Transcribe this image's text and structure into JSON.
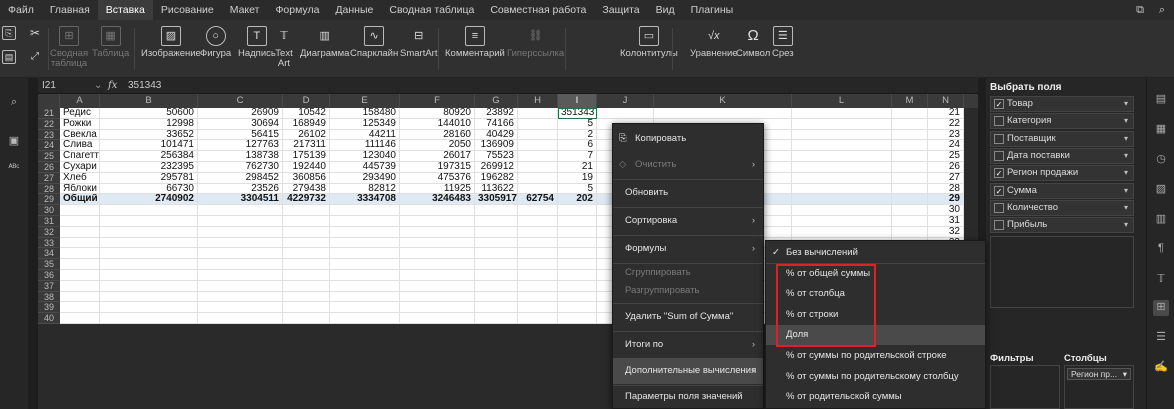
{
  "menu": [
    "Файл",
    "Главная",
    "Вставка",
    "Рисование",
    "Макет",
    "Формула",
    "Данные",
    "Сводная таблица",
    "Совместная работа",
    "Защита",
    "Вид",
    "Плагины"
  ],
  "menu_active": "Вставка",
  "ribbon": {
    "svodnaya": "Сводная таблица",
    "tablica": "Таблица",
    "izobr": "Изображение",
    "figura": "Фигура",
    "nadpis": "Надпись",
    "text_art": "Text Art",
    "diagramma": "Диаграмма",
    "sparklain": "Спарклайн",
    "smartart": "SmartArt",
    "komment": "Комментарий",
    "giperssylka": "Гиперссылка",
    "kolontituly": "Колонтитулы",
    "uravnenie": "Уравнение",
    "simvol": "Символ",
    "srez": "Срез"
  },
  "formula_bar": {
    "cell_ref": "I21",
    "fx": "fx",
    "value": "351343"
  },
  "columns": [
    "A",
    "B",
    "C",
    "D",
    "E",
    "F",
    "G",
    "H",
    "I",
    "J",
    "K",
    "L",
    "M",
    "N"
  ],
  "rows": [
    {
      "n": "21",
      "a": "Редис",
      "b": "50600",
      "c": "26909",
      "d": "10542",
      "e": "158480",
      "f": "80920",
      "g": "23892",
      "i": "351343"
    },
    {
      "n": "22",
      "a": "Рожки",
      "b": "12998",
      "c": "30694",
      "d": "168949",
      "e": "125349",
      "f": "144010",
      "g": "74166",
      "i": "5"
    },
    {
      "n": "23",
      "a": "Свекла",
      "b": "33652",
      "c": "56415",
      "d": "26102",
      "e": "44211",
      "f": "28160",
      "g": "40429",
      "i": "2"
    },
    {
      "n": "24",
      "a": "Слива",
      "b": "101471",
      "c": "127763",
      "d": "217311",
      "e": "111146",
      "f": "2050",
      "g": "136909",
      "i": "6"
    },
    {
      "n": "25",
      "a": "Спагетти",
      "b": "256384",
      "c": "138738",
      "d": "175139",
      "e": "123040",
      "f": "26017",
      "g": "75523",
      "i": "7"
    },
    {
      "n": "26",
      "a": "Сухари",
      "b": "232395",
      "c": "762730",
      "d": "192440",
      "e": "445739",
      "f": "197315",
      "g": "269912",
      "i": "21"
    },
    {
      "n": "27",
      "a": "Хлеб",
      "b": "295781",
      "c": "298452",
      "d": "360856",
      "e": "293490",
      "f": "475376",
      "g": "196282",
      "i": "19"
    },
    {
      "n": "28",
      "a": "Яблоки",
      "b": "66730",
      "c": "23526",
      "d": "279438",
      "e": "82812",
      "f": "11925",
      "g": "113622",
      "i": "5"
    },
    {
      "n": "29",
      "a": "Общий итог",
      "b": "2740902",
      "c": "3304511",
      "d": "4229732",
      "e": "3334708",
      "f": "3246483",
      "g": "3305917",
      "h": "62754",
      "i": "202"
    },
    {
      "n": "30"
    },
    {
      "n": "31"
    },
    {
      "n": "32"
    },
    {
      "n": "33"
    },
    {
      "n": "34"
    },
    {
      "n": "35"
    },
    {
      "n": "36"
    },
    {
      "n": "37"
    },
    {
      "n": "38"
    },
    {
      "n": "39"
    },
    {
      "n": "40"
    }
  ],
  "context_menu": {
    "copy": "Копировать",
    "clear": "Очистить",
    "refresh": "Обновить",
    "sort": "Сортировка",
    "formulas": "Формулы",
    "group": "Сгруппировать",
    "ungroup": "Разгруппировать",
    "delete": "Удалить \"Sum of Сумма\"",
    "totals": "Итоги по",
    "additional": "Дополнительные вычисления",
    "value_field": "Параметры поля значений",
    "pivot_params": "Параметры сводной таблицы"
  },
  "submenu": [
    "Без вычислений",
    "% от общей суммы",
    "% от столбца",
    "% от строки",
    "Доля",
    "% от суммы по родительской строке",
    "% от суммы по родительскому столбцу",
    "% от родительской суммы"
  ],
  "submenu_checked": "Без вычислений",
  "pane": {
    "title": "Выбрать поля",
    "fields": [
      {
        "name": "Товар",
        "checked": true
      },
      {
        "name": "Категория",
        "checked": false
      },
      {
        "name": "Поставщик",
        "checked": false
      },
      {
        "name": "Дата поставки",
        "checked": false
      },
      {
        "name": "Регион продажи",
        "checked": true
      },
      {
        "name": "Сумма",
        "checked": true
      },
      {
        "name": "Количество",
        "checked": false
      },
      {
        "name": "Прибыль",
        "checked": false
      }
    ],
    "filters_label": "Фильтры",
    "columns_label": "Столбцы",
    "columns_item": "Регион пр..."
  }
}
